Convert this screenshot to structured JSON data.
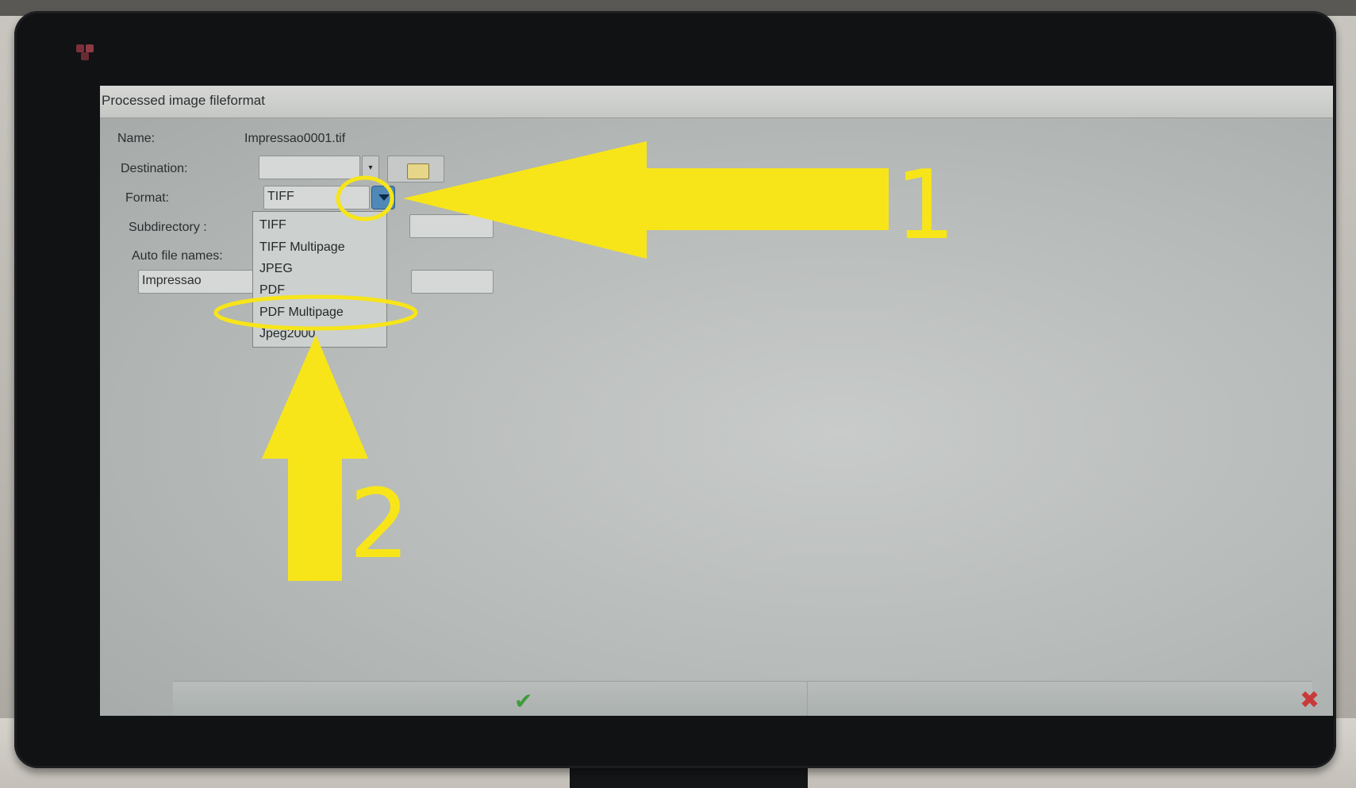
{
  "window": {
    "title": "Processed image fileformat"
  },
  "form": {
    "name_label": "Name:",
    "name_value": "Impressao0001.tif",
    "destination_label": "Destination:",
    "destination_value": "",
    "format_label": "Format:",
    "format_value": "TIFF",
    "subdirectory_label": "Subdirectory :",
    "auto_file_names_label": "Auto file names:",
    "prefix_value": "Impressao"
  },
  "format_options": [
    "TIFF",
    "TIFF Multipage",
    "JPEG",
    "PDF",
    "PDF Multipage",
    "Jpeg2000"
  ],
  "annotations": {
    "step1": "1",
    "step2": "2",
    "color": "#f7e51a"
  },
  "footer": {
    "ok_icon": "check-icon",
    "cancel_icon": "x-icon"
  }
}
